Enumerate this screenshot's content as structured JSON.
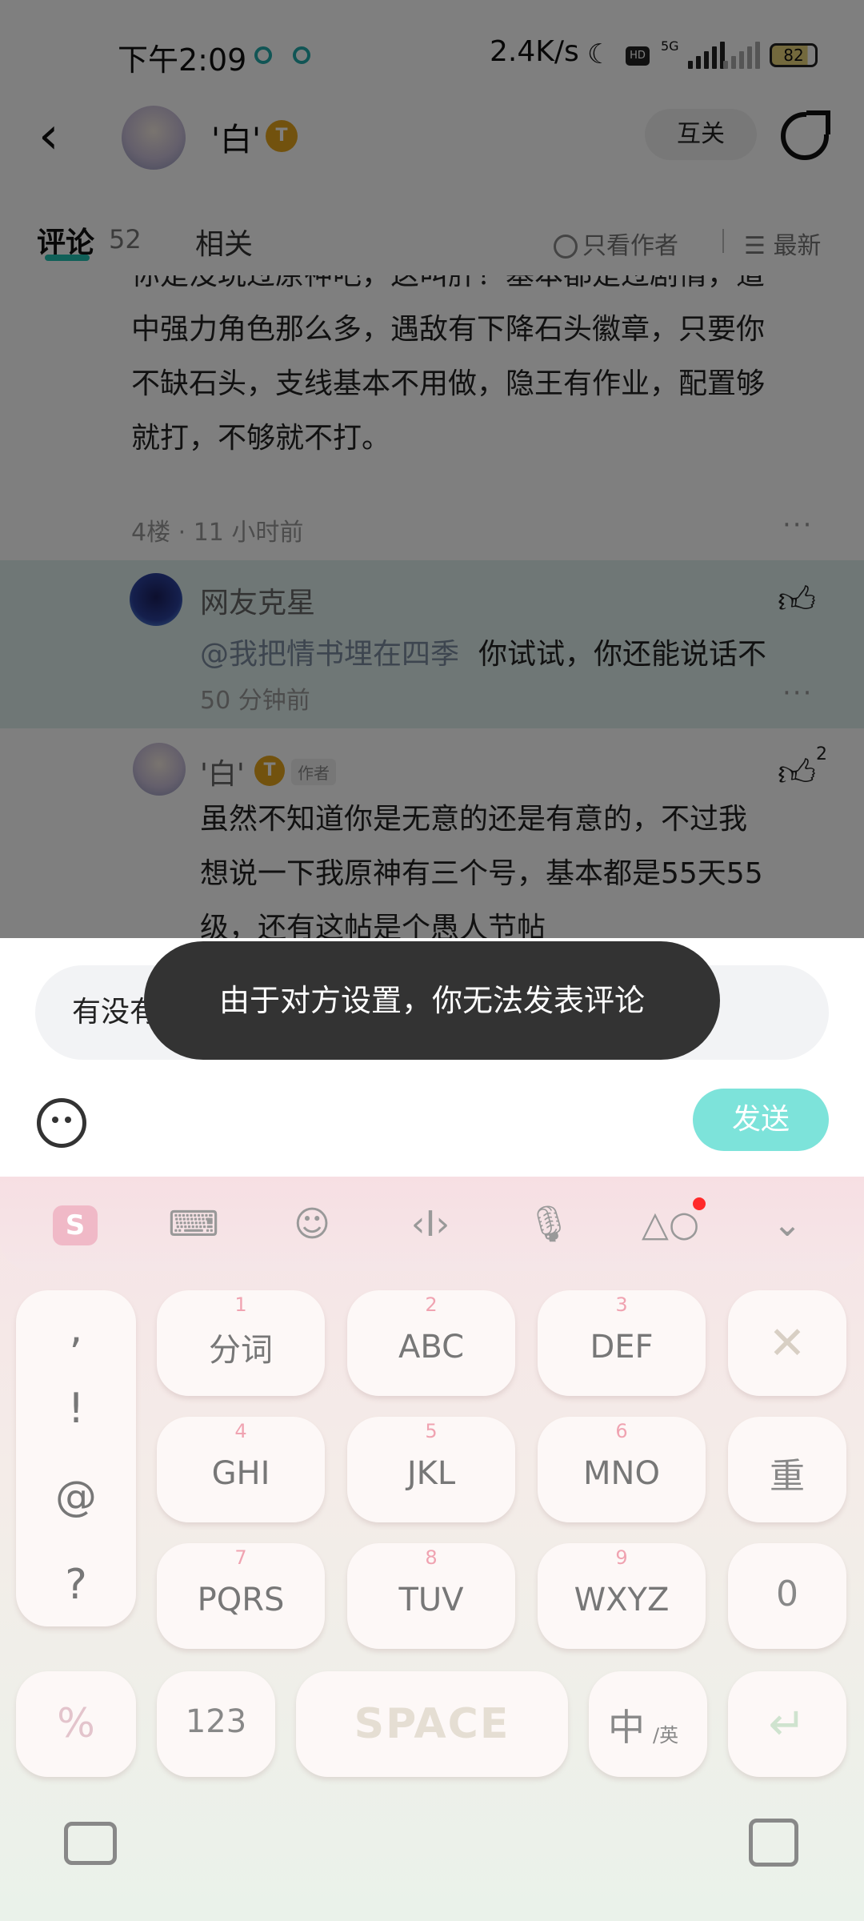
{
  "status_bar": {
    "time": "下午2:09",
    "speed": "2.4K/s",
    "hd": "HD",
    "network": "5G",
    "battery": "82"
  },
  "header": {
    "name": "'白'",
    "badge": "T",
    "mutual_label": "互关"
  },
  "tabs": {
    "comments": "评论",
    "comment_count": "52",
    "related": "相关",
    "only_author": "只看作者",
    "sort": "最新"
  },
  "post": {
    "lines": [
      "你是没玩过原神吧，这叫肝？基本都是过剧情，道",
      "中强力角色那么多，遇敌有下降石头徽章，只要你",
      "不缺石头，支线基本不用做，隐王有作业，配置够",
      "就打，不够就不打。"
    ],
    "meta": "4楼 · 11 小时前",
    "more": "···"
  },
  "reply1": {
    "name": "网友克星",
    "mention": "@我把情书埋在四季",
    "text": "你试试，你还能说话不",
    "time": "50 分钟前",
    "more": "···"
  },
  "reply2": {
    "name": "'白'",
    "badge": "T",
    "tag": "作者",
    "likes": "2",
    "lines": [
      "虽然不知道你是无意的还是有意的，不过我",
      "想说一下我原神有三个号，基本都是55天55",
      "级，还有这帖是个愚人节帖"
    ]
  },
  "input": {
    "value": "有没有"
  },
  "send_label": "发送",
  "toast": "由于对方设置，你无法发表评论",
  "keyboard": {
    "logo": "S",
    "punct": [
      ",",
      "!",
      "@",
      "?"
    ],
    "keys": [
      {
        "num": "1",
        "label": "分词"
      },
      {
        "num": "2",
        "label": "ABC"
      },
      {
        "num": "3",
        "label": "DEF"
      },
      {
        "num": "4",
        "label": "GHI"
      },
      {
        "num": "5",
        "label": "JKL"
      },
      {
        "num": "6",
        "label": "MNO"
      },
      {
        "num": "7",
        "label": "PQRS"
      },
      {
        "num": "8",
        "label": "TUV"
      },
      {
        "num": "9",
        "label": "WXYZ"
      }
    ],
    "reset": "重",
    "zero": "0",
    "num_mode": "123",
    "space": "SPACE",
    "lang_main": "中",
    "lang_sub": "/英"
  }
}
